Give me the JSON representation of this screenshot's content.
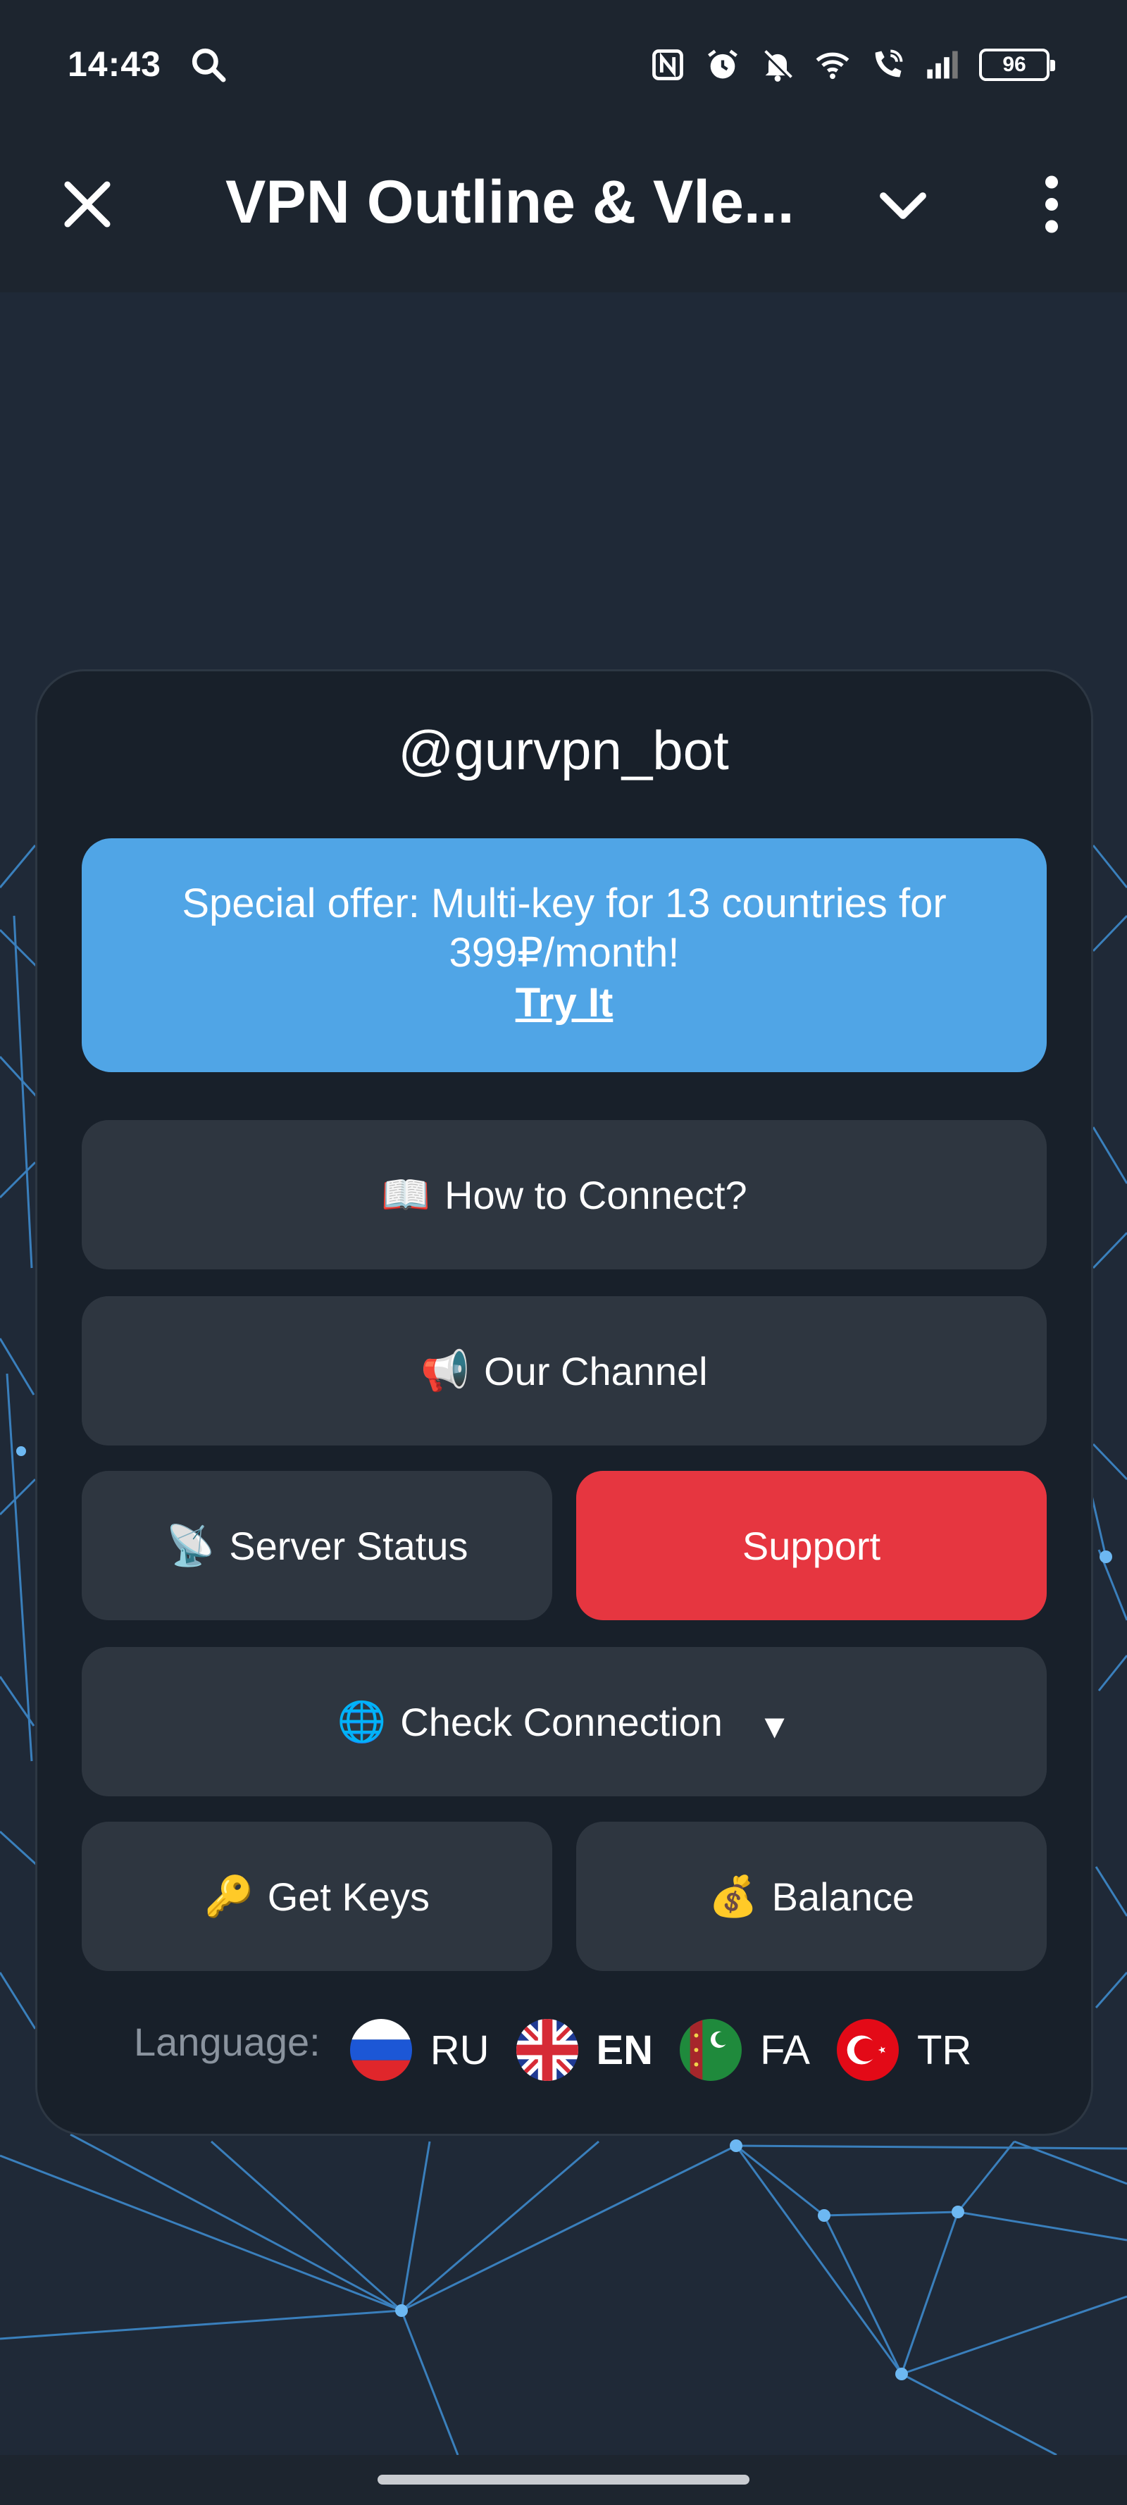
{
  "status_bar": {
    "time": "14:43",
    "battery": "96",
    "icons": [
      "search-icon",
      "nfc-icon",
      "alarm-icon",
      "mute-icon",
      "wifi-icon",
      "wifi-calling-icon",
      "signal-icon",
      "battery-icon"
    ]
  },
  "header": {
    "title": "VPN Outline & Vle..."
  },
  "card": {
    "bot_handle": "@gurvpn_bot",
    "offer": {
      "text": "Special offer: Multi-key for 13 countries for 399₽/month!",
      "link": "Try It"
    },
    "buttons": {
      "how_to_connect": "How to Connect?",
      "our_channel": "Our Channel",
      "server_status": "Server Status",
      "support": "Support",
      "check_connection": "Check Connection",
      "get_keys": "Get Keys",
      "balance": "Balance"
    },
    "emoji": {
      "book": "📖",
      "megaphone": "📢",
      "satellite": "📡",
      "globe": "🌐",
      "key": "🔑",
      "money": "💰",
      "dropdown": "▼"
    },
    "language": {
      "label": "Language:",
      "options": [
        {
          "code": "RU",
          "active": false
        },
        {
          "code": "EN",
          "active": true
        },
        {
          "code": "FA",
          "active": false
        },
        {
          "code": "TR",
          "active": false
        }
      ]
    }
  },
  "colors": {
    "header_bg": "#1d252f",
    "card_bg": "#18202a",
    "button_bg": "#2e3640",
    "offer_bg": "#50a5e6",
    "support_bg": "#e63640",
    "net_line": "#3f8fd4"
  }
}
